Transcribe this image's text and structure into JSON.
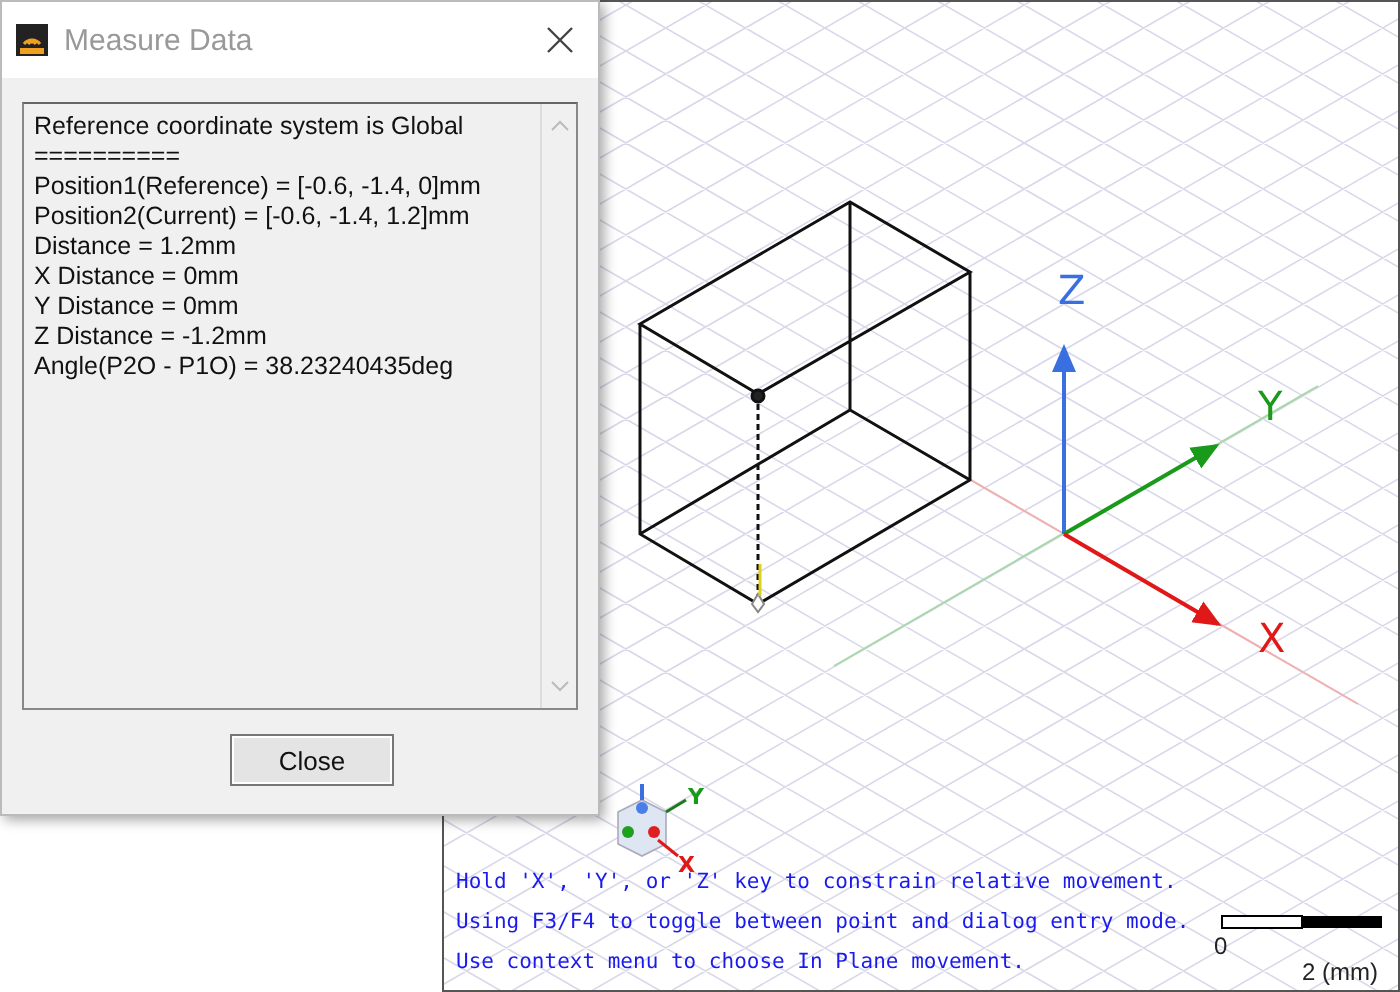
{
  "dialog": {
    "title": "Measure Data",
    "lines": [
      "Reference coordinate system is Global",
      "==========",
      "Position1(Reference) = [-0.6, -1.4, 0]mm",
      "Position2(Current) = [-0.6, -1.4, 1.2]mm",
      "Distance = 1.2mm",
      "X Distance = 0mm",
      "Y Distance = 0mm",
      "Z Distance = -1.2mm",
      "Angle(P2O - P1O) = 38.23240435deg"
    ],
    "close_button": "Close"
  },
  "viewport": {
    "axis_labels": {
      "x": "X",
      "y": "Y",
      "z": "Z"
    },
    "gizmo_labels": {
      "x": "X",
      "y": "Y"
    },
    "hints": [
      "Hold 'X', 'Y', or 'Z' key to constrain relative movement.",
      "Using F3/F4 to toggle between point and dialog entry mode.",
      "Use context menu to choose In Plane movement."
    ],
    "scale_bar": {
      "start": "0",
      "end": "2 (mm)"
    }
  }
}
